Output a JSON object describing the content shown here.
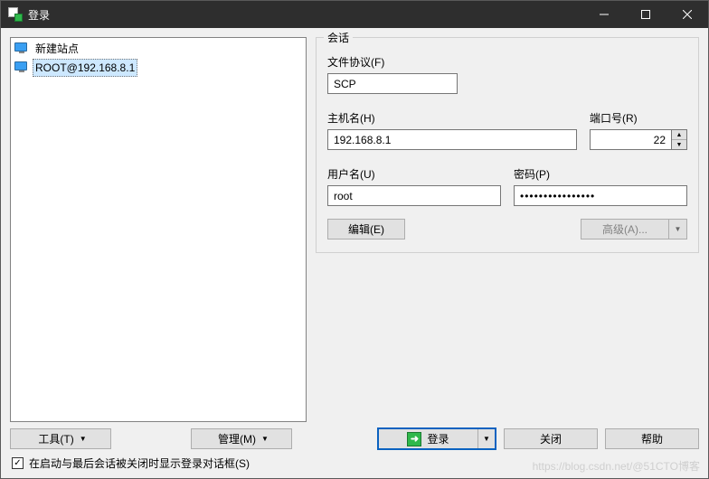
{
  "window": {
    "title": "登录"
  },
  "sites": {
    "items": [
      {
        "label": "新建站点",
        "selected": false
      },
      {
        "label": "ROOT@192.168.8.1",
        "selected": true
      }
    ]
  },
  "session": {
    "legend": "会话",
    "protocol_label": "文件协议(F)",
    "protocol_value": "SCP",
    "host_label": "主机名(H)",
    "host_value": "192.168.8.1",
    "port_label": "端口号(R)",
    "port_value": "22",
    "user_label": "用户名(U)",
    "user_value": "root",
    "pass_label": "密码(P)",
    "pass_value": "••••••••••••••••",
    "edit_button": "编辑(E)",
    "advanced_button": "高级(A)..."
  },
  "bottom": {
    "tools": "工具(T)",
    "manage": "管理(M)",
    "login": "登录",
    "close": "关闭",
    "help": "帮助"
  },
  "checkbox": {
    "label": "在启动与最后会话被关闭时显示登录对话框(S)",
    "checked": "✓"
  },
  "watermark": "https://blog.csdn.net/@51CTO博客"
}
